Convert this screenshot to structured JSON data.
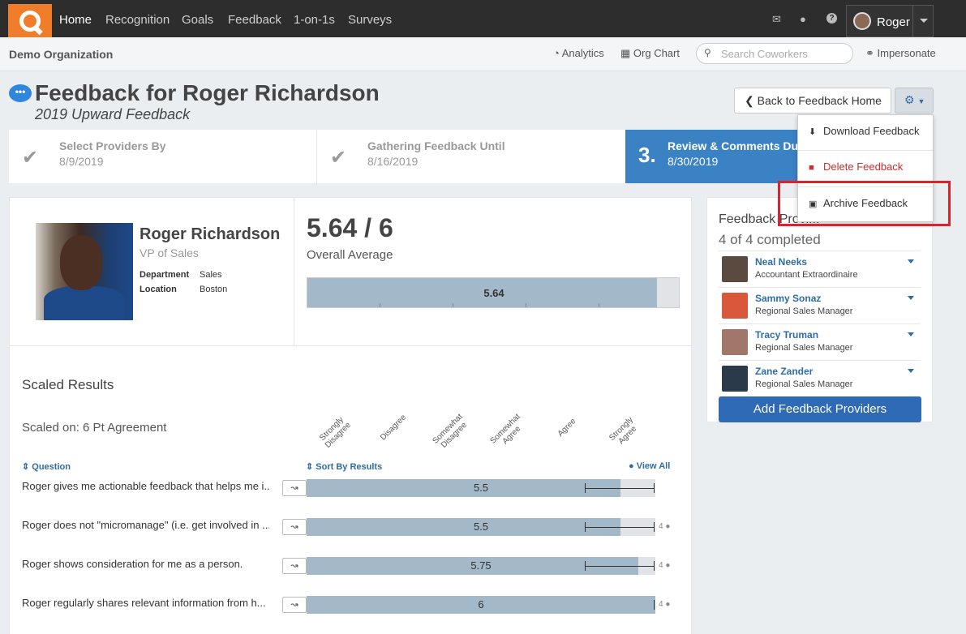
{
  "nav": {
    "items": [
      "Home",
      "Recognition",
      "Goals",
      "Feedback",
      "1-on-1s",
      "Surveys"
    ],
    "user": "Roger"
  },
  "subbar": {
    "org": "Demo Organization",
    "analytics": "Analytics",
    "orgchart": "Org Chart",
    "search_placeholder": "Search Coworkers",
    "impersonate": "Impersonate"
  },
  "page": {
    "title": "Feedback for Roger Richardson",
    "subtitle": "2019 Upward Feedback",
    "back": "Back to Feedback Home"
  },
  "steps": [
    {
      "label": "Select Providers By",
      "date": "8/9/2019"
    },
    {
      "label": "Gathering Feedback Until",
      "date": "8/16/2019"
    },
    {
      "num": "3.",
      "label": "Review & Comments Du",
      "date": "8/30/2019"
    }
  ],
  "profile": {
    "name": "Roger Richardson",
    "role": "VP of Sales",
    "dept_label": "Department",
    "dept": "Sales",
    "loc_label": "Location",
    "loc": "Boston"
  },
  "average": {
    "text": "5.64 / 6",
    "label": "Overall Average",
    "value": "5.64",
    "fraction": 0.94
  },
  "scaled": {
    "title": "Scaled Results",
    "scale": "Scaled on: 6 Pt Agreement",
    "labels": [
      "Strongly Disagree",
      "Disagree",
      "Somewhat Disagree",
      "Somewhat Agree",
      "Agree",
      "Strongly Agree"
    ],
    "col_question": "Question",
    "col_sort": "Sort By Results",
    "view_all": "View All"
  },
  "questions": [
    {
      "text": "Roger gives me actionable feedback that helps me i...",
      "value": "5.5",
      "fraction": 0.9,
      "count": ""
    },
    {
      "text": "Roger does not \"micromanage\" (i.e. get involved in ...",
      "value": "5.5",
      "fraction": 0.9,
      "count": "4"
    },
    {
      "text": "Roger shows consideration for me as a person.",
      "value": "5.75",
      "fraction": 0.95,
      "count": "4"
    },
    {
      "text": "Roger regularly shares relevant information from h...",
      "value": "6",
      "fraction": 1.0,
      "count": "4"
    }
  ],
  "providers": {
    "title": "Feedback Provi...",
    "completed": "4 of 4 completed",
    "add": "Add Feedback Providers",
    "list": [
      {
        "name": "Neal Neeks",
        "role": "Accountant Extraordinaire",
        "color": "#5a4a40"
      },
      {
        "name": "Sammy Sonaz",
        "role": "Regional Sales Manager",
        "color": "#d9573b"
      },
      {
        "name": "Tracy Truman",
        "role": "Regional Sales Manager",
        "color": "#a0776a"
      },
      {
        "name": "Zane Zander",
        "role": "Regional Sales Manager",
        "color": "#2a3a4a"
      }
    ]
  },
  "dropdown": {
    "download": "Download Feedback",
    "delete": "Delete Feedback",
    "archive": "Archive Feedback"
  },
  "colors": {
    "brand": "#f07d2a",
    "accent": "#3b82c4",
    "bar": "#a3b9ca",
    "highlight": "#e0202a"
  }
}
